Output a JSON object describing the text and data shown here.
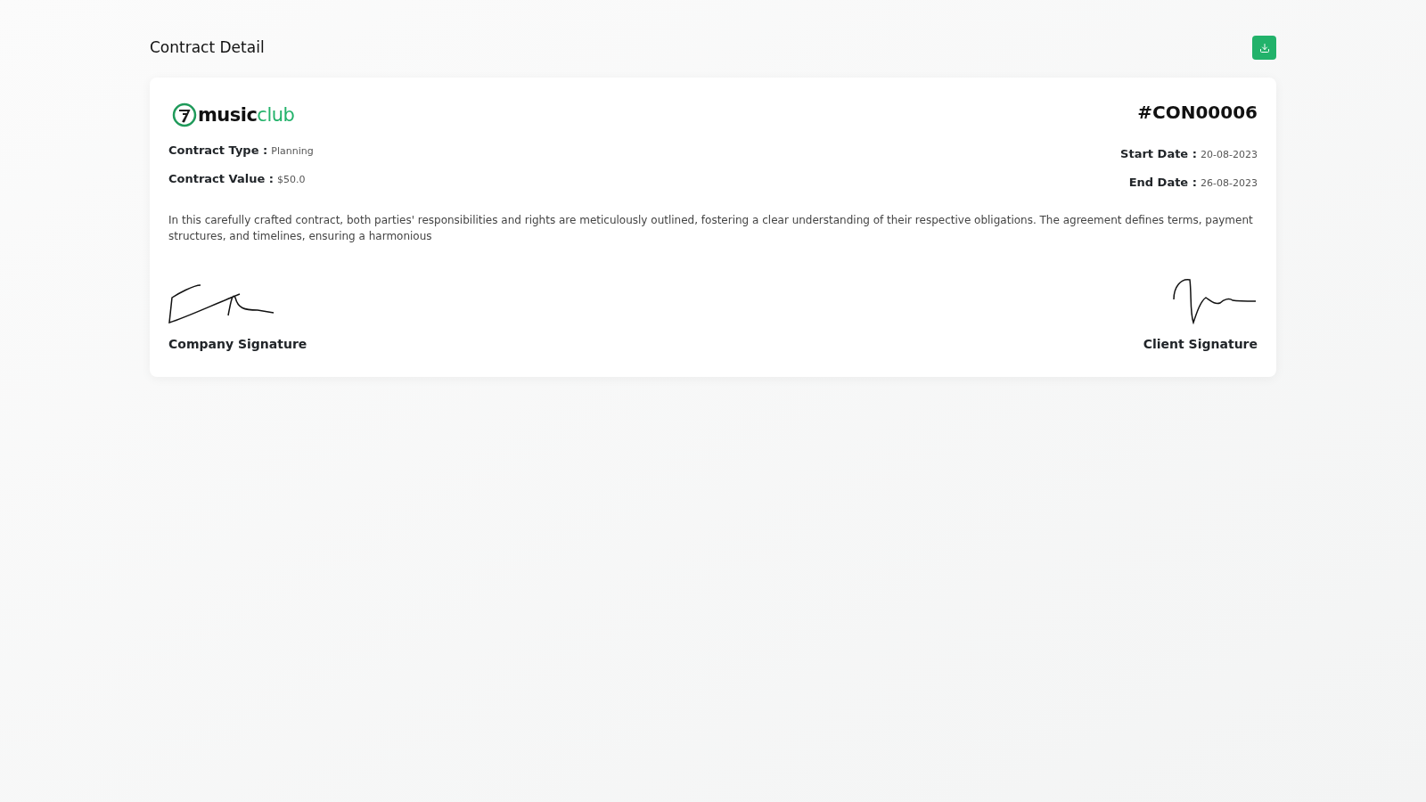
{
  "page": {
    "title": "Contract Detail"
  },
  "logo": {
    "brand": "music",
    "accent": "club"
  },
  "contract": {
    "number": "#CON00006",
    "fields_left": [
      {
        "label": "Contract Type :",
        "value": "Planning"
      },
      {
        "label": "Contract Value :",
        "value": "$50.0"
      }
    ],
    "fields_right": [
      {
        "label": "Start Date :",
        "value": "20-08-2023"
      },
      {
        "label": "End Date :",
        "value": "26-08-2023"
      }
    ],
    "description": "In this carefully crafted contract, both parties' responsibilities and rights are meticulously outlined, fostering a clear understanding of their respective obligations. The agreement defines terms, payment structures, and timelines, ensuring a harmonious"
  },
  "signatures": [
    {
      "label": "Company Signature"
    },
    {
      "label": "Client Signature"
    }
  ]
}
